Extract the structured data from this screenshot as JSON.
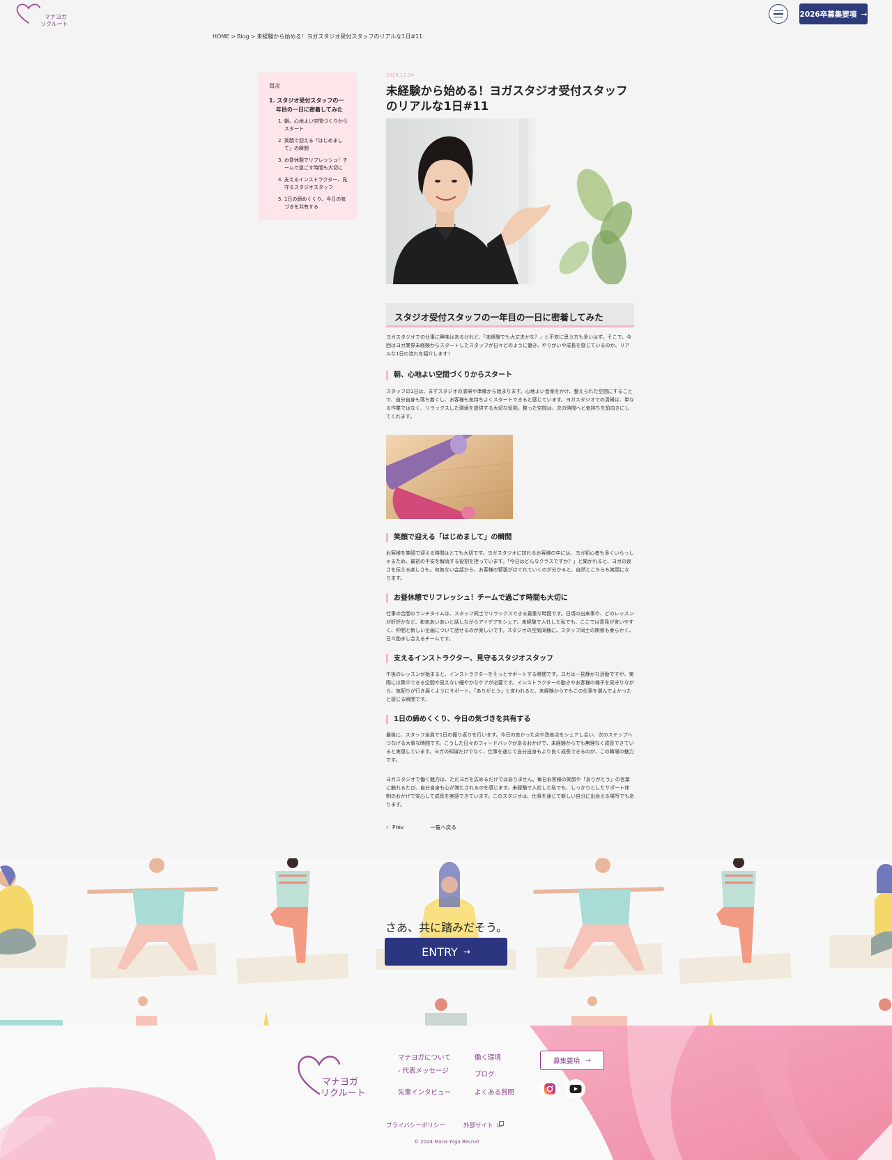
{
  "header": {
    "logo_text_line1": "マナヨガ",
    "logo_text_line2": "リクルート",
    "recruit_button": "2026卒募集要項",
    "arrow": "→"
  },
  "breadcrumb": {
    "home": "HOME",
    "blog": "Blog",
    "current": "未経験から始める！ヨガスタジオ受付スタッフのリアルな1日#11",
    "separator": ">"
  },
  "toc": {
    "title": "目次",
    "main": "1. スタジオ受付スタッフの一年目の一日に密着してみた",
    "items": [
      "1. 朝、心地よい空間づくりからスタート",
      "2. 笑顔で迎える「はじめまして」の瞬間",
      "3. お昼休憩でリフレッシュ！チームで過ごす時間も大切に",
      "4. 支えるインストラクター、見守るスタジオスタッフ",
      "5. 1日の締めくくり、今日の気づきを共有する"
    ]
  },
  "article": {
    "date": "2024.12.24",
    "title": "未経験から始める！ヨガスタジオ受付スタッフのリアルな1日#11",
    "h2": "スタジオ受付スタッフの一年目の一日に密着してみた",
    "intro": "ヨガスタジオでの仕事に興味はあるけれど、「未経験でも大丈夫かな？」と不安に思う方も多いはず。そこで、今回はヨガ業界未経験からスタートしたスタッフが日々どのように働き、やりがいや成長を感じているのか、リアルな1日の流れを紹介します！",
    "sections": [
      {
        "heading": "朝、心地よい空間づくりからスタート",
        "body": "スタッフの1日は、まずスタジオの清掃や準備から始まります。心地よい音楽をかけ、整えられた空間にすることで、自分自身も落ち着くし、お客様も気持ちよくスタートできると感じています。ヨガスタジオでの清掃は、単なる作業ではなく、リラックスした環境を提供する大切な役割。整った空間は、次の時間へと気持ちを前向きにしてくれます。"
      },
      {
        "heading": "笑顔で迎える「はじめまして」の瞬間",
        "body": "お客様を笑顔で迎える時間はとても大切です。ヨガスタジオに訪れるお客様の中には、ヨガ初心者も多くいらっしゃるため、最初の不安を解消する役割を担っています。「今日はどんなクラスですか？」と聞かれると、ヨガの良さを伝える楽しさも。何気ない会話から、お客様の緊張がほぐれていくのが分かると、自然とこちらも笑顔になります。"
      },
      {
        "heading": "お昼休憩でリフレッシュ！チームで過ごす時間も大切に",
        "body": "仕事の合間のランチタイムは、スタッフ同士でリラックスできる貴重な時間です。日頃の出来事や、どのレッスンが好評かなど、和気あいあいと話しながらアイデアをシェア。未経験で入社した私でも、ここでは意見が言いやすく、仲間と新しい企画について話せるのが楽しいです。スタジオの空気同様に、スタッフ同士の関係も柔らかく、日々励まし合えるチームです。"
      },
      {
        "heading": "支えるインストラクター、見守るスタジオスタッフ",
        "body": "午後のレッスンが始まると、インストラクターをそっとサポートする時間です。ヨガは一見静かな活動ですが、実際には集中できる空間や見えない細やかなケアが必要です。インストラクターの動きやお客様の様子を見守りながら、気配りが行き届くようにサポート。「ありがとう」と言われると、未経験からでもこの仕事を選んでよかったと感じる瞬間です。"
      },
      {
        "heading": "1日の締めくくり、今日の気づきを共有する",
        "body": "最後に、スタッフ全員で1日の振り返りを行います。今日の良かった点や改善点をシェアし合い、次のステップへつなげる大事な時間です。こうした日々のフィードバックがあるおかげで、未経験からでも無理なく成長できていると実感しています。ヨガの知識だけでなく、仕事を通じて自分自身もより良く成長できるのが、この職場の魅力です。"
      }
    ],
    "closing": "ヨガスタジオで働く魅力は、ただヨガを広めるだけではありません。毎日お客様の笑顔や「ありがとう」の言葉に触れるたび、自分自身も心が満たされるのを感じます。未経験で入社した私でも、しっかりとしたサポート体制のおかげで安心して成長を実感できています。このスタジオは、仕事を通じて新しい自分に出会える場所でもあります。",
    "pager_prev": "Prev",
    "pager_prev_icon": "‹",
    "pager_back": "一覧へ戻る"
  },
  "cta": {
    "text": "さあ、共に踏みだそう。",
    "entry_button": "ENTRY",
    "arrow": "→"
  },
  "footer": {
    "logo_line1": "マナヨガ",
    "logo_line2": "リクルート",
    "links": {
      "about": "マナヨガについて",
      "message": "- 代表メッセージ",
      "interview": "先輩インタビュー",
      "environment": "働く環境",
      "blog": "ブログ",
      "faq": "よくある質問"
    },
    "recruit_button": "募集要項",
    "privacy": "プライバシーポリシー",
    "external": "外部サイト",
    "copyright": "© 2024 Mana Yoga Recruit"
  },
  "colors": {
    "navy": "#2e3b7a",
    "purple": "#8a3d8c",
    "pink_accent": "#f4b8c6",
    "toc_bg": "#fde6ea"
  }
}
